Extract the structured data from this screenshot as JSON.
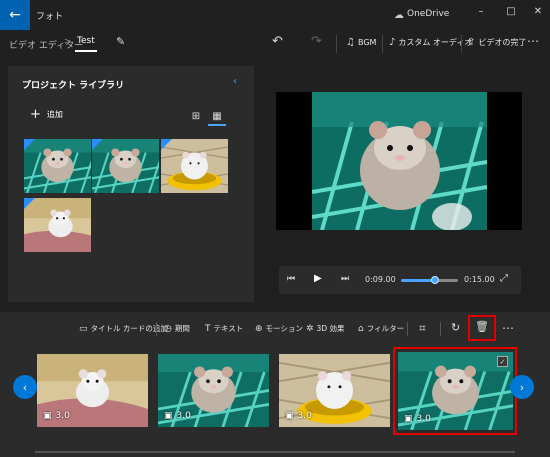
{
  "titlebar": {
    "app_title": "フォト",
    "onedrive_label": "OneDrive",
    "minimize": "–",
    "maximize": "□",
    "close": "✕"
  },
  "breadcrumb": {
    "parent": "ビデオ エディター",
    "separator": ">",
    "current": "Test"
  },
  "commands": {
    "bgm": "BGM",
    "custom_audio": "カスタム オーディオ",
    "finish_video": "ビデオの完了"
  },
  "library": {
    "title": "プロジェクト ライブラリ",
    "add_label": "追加"
  },
  "player": {
    "current_time": "0:09.00",
    "total_time": "0:15.00",
    "progress": 0.6
  },
  "storyboard_toolbar": {
    "add_title_card": "タイトル カードの追加",
    "duration": "期間",
    "text": "テキスト",
    "motion": "モーション",
    "effects_3d": "3D 効果",
    "filters": "フィルター"
  },
  "storyboard": {
    "cards": [
      {
        "duration": "3.0"
      },
      {
        "duration": "3.0"
      },
      {
        "duration": "3.0"
      },
      {
        "duration": "3.0"
      }
    ]
  },
  "colors": {
    "accent": "#0078d7",
    "highlight": "#e00000",
    "background": "#202020",
    "panel": "#2b2b2b"
  }
}
